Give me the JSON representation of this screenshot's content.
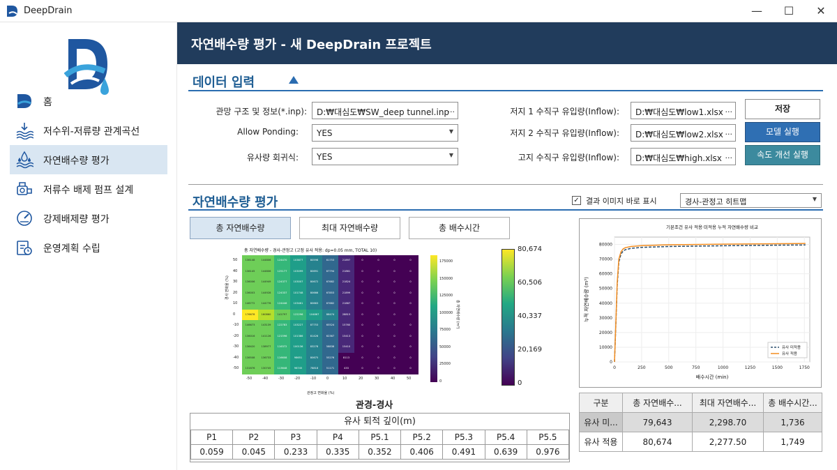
{
  "app": {
    "title": "DeepDrain"
  },
  "window_controls": {
    "minimize": "—",
    "maximize": "☐",
    "close": "✕"
  },
  "sidebar": {
    "items": [
      {
        "label": "홈",
        "icon": "home-logo-icon"
      },
      {
        "label": "저수위-저류량 관계곡선",
        "icon": "water-level-icon"
      },
      {
        "label": "자연배수량 평가",
        "icon": "drainage-icon"
      },
      {
        "label": "저류수 배제 펌프 설계",
        "icon": "pump-icon"
      },
      {
        "label": "강제배제량 평가",
        "icon": "gauge-icon"
      },
      {
        "label": "운영계획 수립",
        "icon": "clipboard-icon"
      }
    ]
  },
  "header": {
    "title": "자연배수량 평가 - 새 DeepDrain 프로젝트"
  },
  "data_input": {
    "title": "데이터 입력",
    "network_label": "관망 구조 및 정보(*.inp):",
    "network_value": "D:₩대심도₩SW_deep tunnel.inp",
    "ponding_label": "Allow Ponding:",
    "ponding_value": "YES",
    "sediment_label": "유사량 회귀식:",
    "sediment_value": "YES",
    "low1_label": "저지 1 수직구 유입량(Inflow):",
    "low1_value": "D:₩대심도₩low1.xlsx",
    "low2_label": "저지 2 수직구 유입량(Inflow):",
    "low2_value": "D:₩대심도₩low2.xlsx",
    "high_label": "고지 수직구 유입량(Inflow):",
    "high_value": "D:₩대심도₩high.xlsx",
    "ellipsis": "...",
    "save_label": "저장",
    "run_label": "모델 실행",
    "speed_label": "속도 개선 실행"
  },
  "evaluation": {
    "title": "자연배수량 평가",
    "show_image_label": "결과 이미지 바로 표시",
    "show_image_checked": "✓",
    "view_select": "경사-관정고 히트맵",
    "tabs": [
      "총 자연배수량",
      "최대 자연배수량",
      "총 배수시간"
    ],
    "active_tab": 0
  },
  "heatmap": {
    "title": "총 자연배수량 - 경사-관정고 (고정 유사 적용: dp=0.05 mm, TOTAL 10)",
    "ylabel": "경사 변화율 (%)",
    "xlabel": "관정고 변화율 (%)",
    "x_ticks": [
      "-50",
      "-40",
      "-30",
      "-20",
      "-10",
      "0",
      "10",
      "20",
      "30",
      "40",
      "50"
    ],
    "y_ticks": [
      "50",
      "40",
      "30",
      "20",
      "10",
      "0",
      "-10",
      "-20",
      "-30",
      "-40",
      "-50"
    ],
    "colorbar_ticks": [
      "175000",
      "150000",
      "125000",
      "100000",
      "75000",
      "50000",
      "25000",
      "0"
    ],
    "colorbar_label": "총 자연배수량 (m³)",
    "big_colorbar_ticks": [
      "80,674",
      "60,506",
      "40,337",
      "20,169",
      "0"
    ],
    "caption": "관경-경사",
    "cells": [
      [
        "136148",
        "144806",
        "124470",
        "103877",
        "80598",
        "61753",
        "21897",
        "0",
        "0",
        "0",
        "0"
      ],
      [
        "136145",
        "144806",
        "125177",
        "103099",
        "80691",
        "67794",
        "21861",
        "0",
        "0",
        "0",
        "0"
      ],
      [
        "136006",
        "144949",
        "124377",
        "103007",
        "80672",
        "67682",
        "21824",
        "0",
        "0",
        "0",
        "0"
      ],
      [
        "136003",
        "144928",
        "124337",
        "101748",
        "80666",
        "67853",
        "21899",
        "0",
        "0",
        "0",
        "0"
      ],
      [
        "146772",
        "144776",
        "124446",
        "103461",
        "80663",
        "67682",
        "21887",
        "0",
        "0",
        "0",
        "0"
      ],
      [
        "176678",
        "160860",
        "141797",
        "122296",
        "104867",
        "88474",
        "28815",
        "0",
        "0",
        "0",
        "0"
      ],
      [
        "146673",
        "143139",
        "122783",
        "103227",
        "87753",
        "65524",
        "15760",
        "0",
        "0",
        "0",
        "0"
      ],
      [
        "136016",
        "141126",
        "121596",
        "101386",
        "81426",
        "62367",
        "15413",
        "0",
        "0",
        "0",
        "0"
      ],
      [
        "136420",
        "138977",
        "116372",
        "100136",
        "83278",
        "58838",
        "15410",
        "0",
        "0",
        "0",
        "0"
      ],
      [
        "136508",
        "136733",
        "116608",
        "98651",
        "80675",
        "55276",
        "8113",
        "0",
        "0",
        "0",
        "0"
      ],
      [
        "131876",
        "130745",
        "113648",
        "96745",
        "78818",
        "51171",
        "433",
        "0",
        "0",
        "0",
        "0"
      ]
    ]
  },
  "sediment_table": {
    "title": "유사 퇴적 깊이(m)",
    "headers": [
      "P1",
      "P2",
      "P3",
      "P4",
      "P5.1",
      "P5.2",
      "P5.3",
      "P5.4",
      "P5.5"
    ],
    "values": [
      "0.059",
      "0.045",
      "0.233",
      "0.335",
      "0.352",
      "0.406",
      "0.491",
      "0.639",
      "0.976"
    ]
  },
  "line_chart": {
    "title": "기본조건 유사 적용·미적용 누적 자연배수량 비교",
    "xlabel": "배수시간 (min)",
    "ylabel": "누적 자연배수량 (m³)",
    "x_ticks": [
      "0",
      "250",
      "500",
      "750",
      "1000",
      "1250",
      "1500",
      "1750"
    ],
    "y_ticks": [
      "80000",
      "70000",
      "60000",
      "50000",
      "40000",
      "30000",
      "20000",
      "10000",
      "0"
    ],
    "legend": [
      "유사 미적용",
      "유사 적용"
    ]
  },
  "chart_data": {
    "type": "line",
    "title": "기본조건 유사 적용·미적용 누적 자연배수량 비교",
    "xlabel": "배수시간 (min)",
    "ylabel": "누적 자연배수량 (m³)",
    "xlim": [
      0,
      1800
    ],
    "ylim": [
      0,
      85000
    ],
    "grid": true,
    "legend_position": "bottom-right",
    "series": [
      {
        "name": "유사 미적용",
        "color": "#2b4e6e",
        "style": "dashed",
        "x": [
          0,
          10,
          25,
          40,
          60,
          80,
          100,
          150,
          250,
          500,
          1000,
          1500,
          1760
        ],
        "y": [
          0,
          20000,
          52000,
          68000,
          73500,
          75500,
          76400,
          77300,
          78000,
          78600,
          79100,
          79500,
          79643
        ]
      },
      {
        "name": "유사 적용",
        "color": "#f28c1f",
        "style": "solid",
        "x": [
          0,
          10,
          25,
          40,
          60,
          80,
          100,
          150,
          250,
          500,
          1000,
          1500,
          1760
        ],
        "y": [
          0,
          21000,
          54000,
          70000,
          75000,
          77000,
          77800,
          78600,
          79200,
          79800,
          80200,
          80500,
          80674
        ]
      }
    ]
  },
  "summary_table": {
    "headers": [
      "구분",
      "총 자연배수...",
      "최대 자연배수...",
      "총 배수시간..."
    ],
    "rows": [
      [
        "유사 미...",
        "79,643",
        "2,298.70",
        "1,736"
      ],
      [
        "유사 적용",
        "80,674",
        "2,277.50",
        "1,749"
      ]
    ]
  },
  "colors": {
    "header": "#213c5c",
    "accent": "#1e5d93",
    "active_nav": "#d9e6f2",
    "run_button": "#2f6fb3",
    "speed_button": "#3c8a9e"
  }
}
